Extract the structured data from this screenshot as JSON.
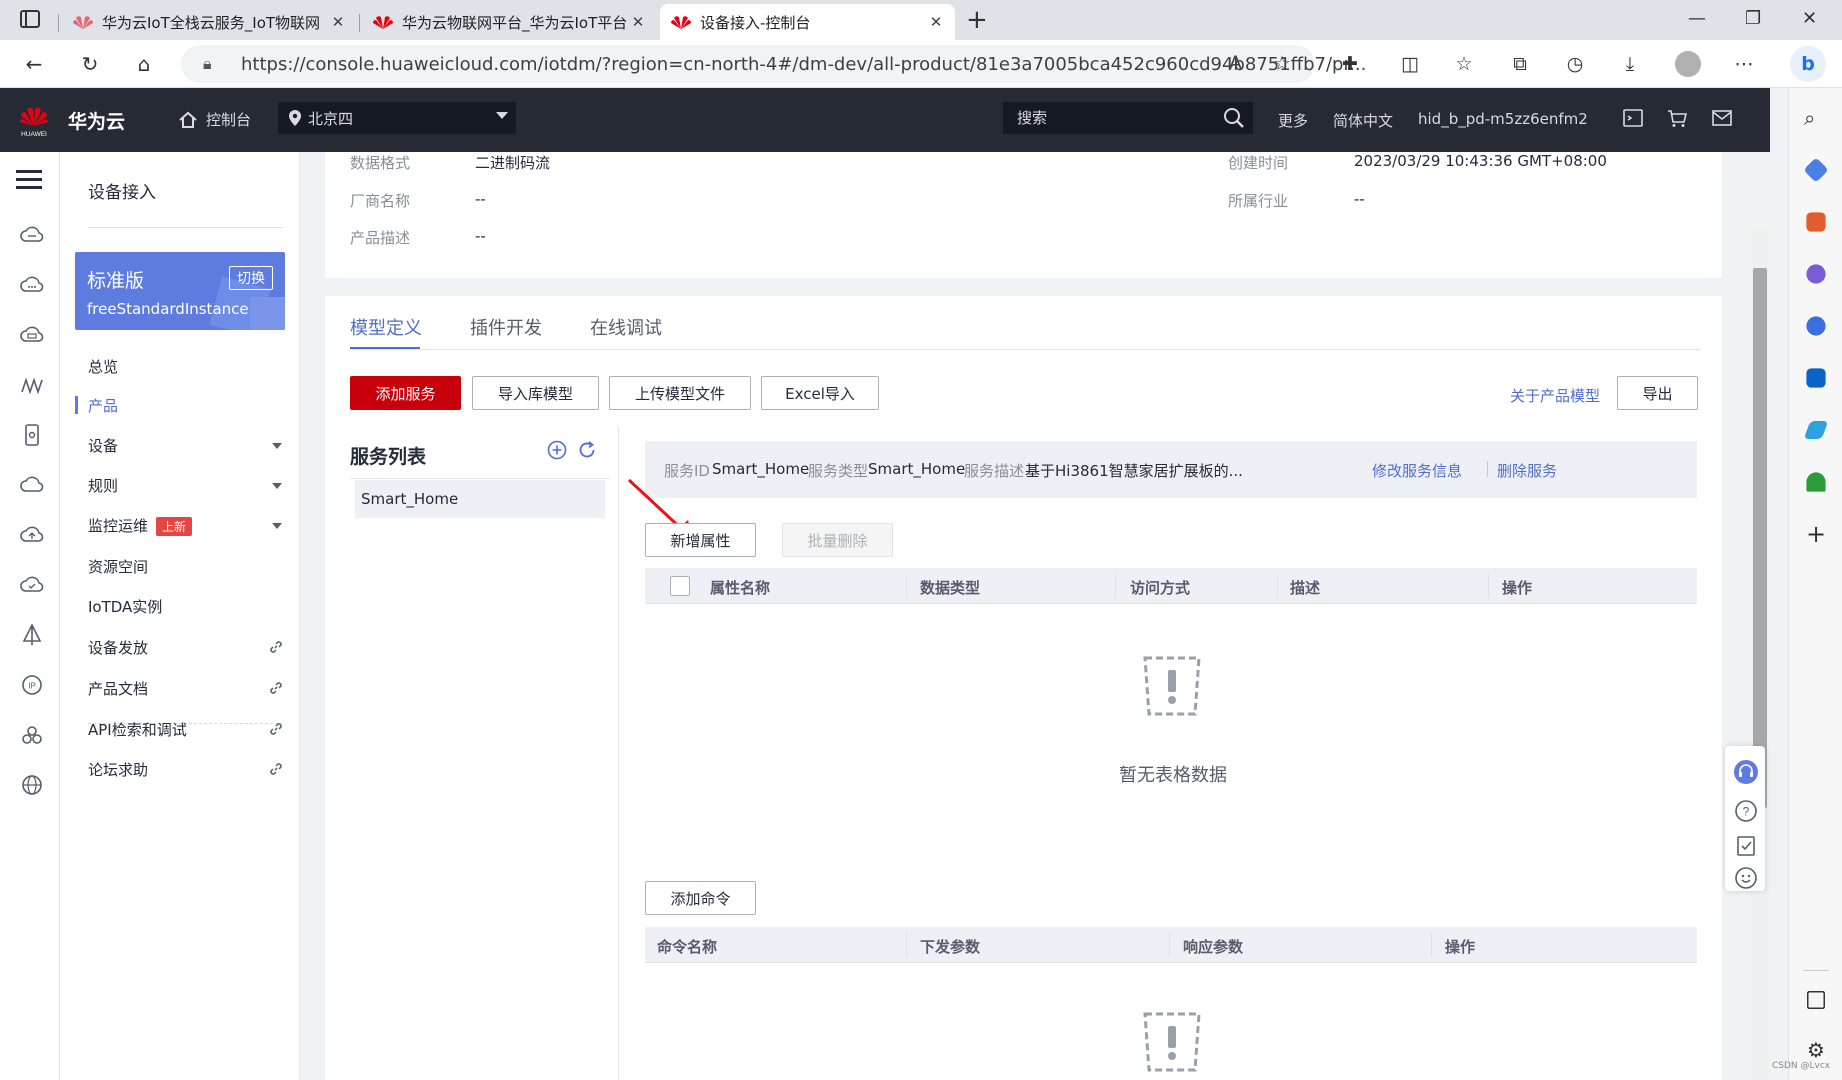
{
  "browser": {
    "tabs": [
      {
        "title": "华为云IoT全栈云服务_IoT物联网",
        "active": false
      },
      {
        "title": "华为云物联网平台_华为云IoT平台",
        "active": false
      },
      {
        "title": "设备接入-控制台",
        "active": true
      }
    ],
    "url": "https://console.huaweicloud.com/iotdm/?region=cn-north-4#/dm-dev/all-product/81e3a7005bca452c960cd94b8751ffb7/pr...",
    "accent": "#5e7ce0"
  },
  "header": {
    "logo_text": "HUAWEI",
    "brand": "华为云",
    "console": "控制台",
    "region": "北京四",
    "search_placeholder": "搜索",
    "more": "更多",
    "language": "简体中文",
    "user": "hid_b_pd-m5zz6enfm2"
  },
  "sidebar": {
    "title": "设备接入",
    "instance": {
      "edition": "标准版",
      "switch": "切换",
      "id": "freeStandardInstance"
    },
    "items": [
      {
        "label": "总览"
      },
      {
        "label": "产品"
      },
      {
        "label": "设备"
      },
      {
        "label": "规则"
      },
      {
        "label": "监控运维",
        "badge": "上新"
      },
      {
        "label": "资源空间"
      },
      {
        "label": "IoTDA实例"
      },
      {
        "label": "设备发放"
      },
      {
        "label": "产品文档"
      },
      {
        "label": "API检索和调试"
      },
      {
        "label": "论坛求助"
      }
    ]
  },
  "basic_info": {
    "data_format_label": "数据格式",
    "data_format": "二进制码流",
    "created_label": "创建时间",
    "created": "2023/03/29 10:43:36 GMT+08:00",
    "vendor_label": "厂商名称",
    "vendor": "--",
    "industry_label": "所属行业",
    "industry": "--",
    "desc_label": "产品描述",
    "desc": "--"
  },
  "main": {
    "tabs": [
      "模型定义",
      "插件开发",
      "在线调试"
    ],
    "buttons": {
      "add_service": "添加服务",
      "import_lib": "导入库模型",
      "upload_model": "上传模型文件",
      "excel_import": "Excel导入",
      "about_model": "关于产品模型",
      "export": "导出"
    },
    "service_list": {
      "title": "服务列表",
      "items": [
        "Smart_Home"
      ]
    },
    "service_info": {
      "id_label": "服务ID",
      "id": "Smart_Home",
      "type_label": "服务类型",
      "type": "Smart_Home",
      "desc_label": "服务描述",
      "desc": "基于Hi3861智慧家居扩展板的...",
      "edit": "修改服务信息",
      "delete": "删除服务"
    },
    "properties": {
      "add": "新增属性",
      "batch_delete": "批量删除",
      "columns": [
        "属性名称",
        "数据类型",
        "访问方式",
        "描述",
        "操作"
      ],
      "empty": "暂无表格数据"
    },
    "commands": {
      "add": "添加命令",
      "columns": [
        "命令名称",
        "下发参数",
        "响应参数",
        "操作"
      ]
    }
  },
  "watermark": "CSDN @Lvcx"
}
